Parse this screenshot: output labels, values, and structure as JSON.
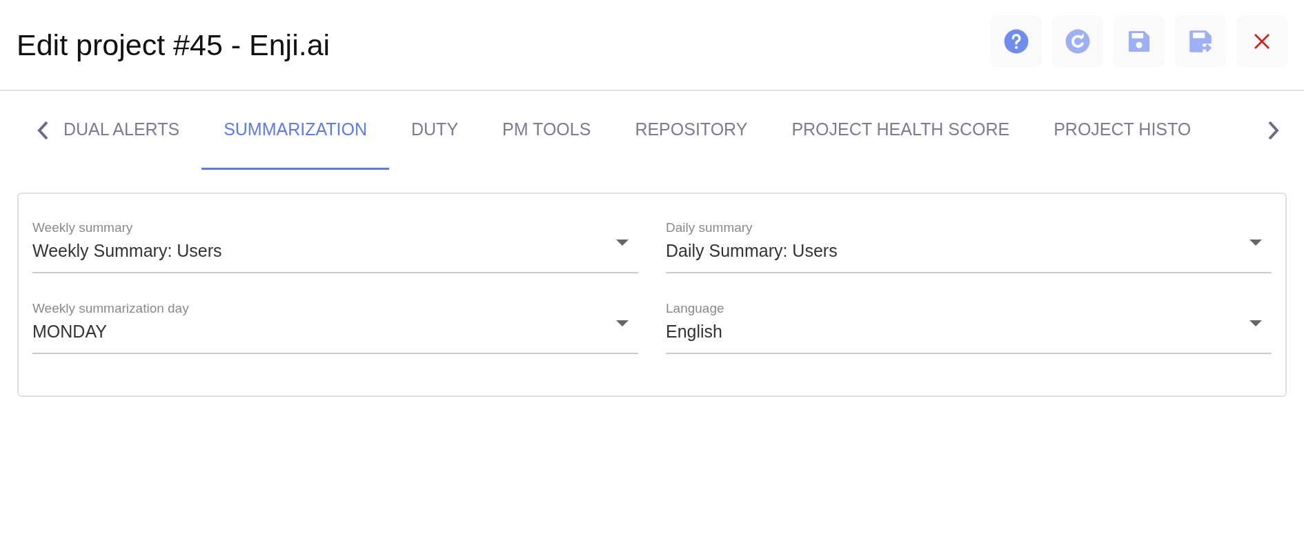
{
  "header": {
    "title": "Edit project #45 - Enji.ai",
    "actions": [
      {
        "kind": "help"
      },
      {
        "kind": "refresh"
      },
      {
        "kind": "save"
      },
      {
        "kind": "save-close"
      },
      {
        "kind": "close"
      }
    ]
  },
  "tabs": [
    {
      "label": "DUAL ALERTS",
      "selected": false
    },
    {
      "label": "SUMMARIZATION",
      "selected": true
    },
    {
      "label": "DUTY",
      "selected": false
    },
    {
      "label": "PM TOOLS",
      "selected": false
    },
    {
      "label": "REPOSITORY",
      "selected": false
    },
    {
      "label": "PROJECT HEALTH SCORE",
      "selected": false
    },
    {
      "label": "PROJECT HISTO",
      "selected": false
    }
  ],
  "fields": [
    {
      "label": "Weekly summary",
      "value": "Weekly Summary: Users"
    },
    {
      "label": "Daily summary",
      "value": "Daily Summary: Users"
    },
    {
      "label": "Weekly summarization day",
      "value": "MONDAY"
    },
    {
      "label": "Language",
      "value": "English"
    }
  ]
}
